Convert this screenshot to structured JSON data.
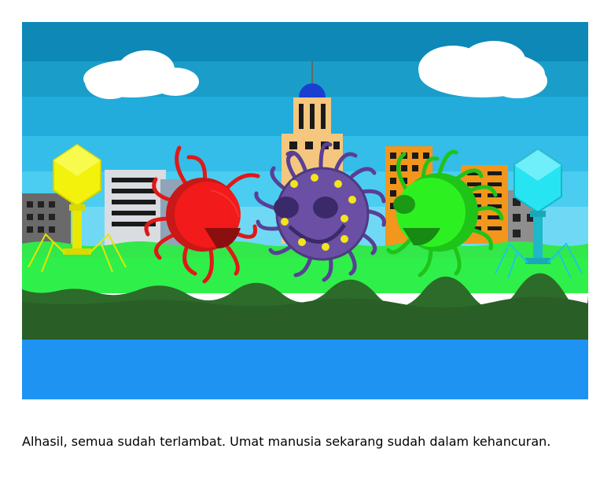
{
  "story": {
    "caption": "Alhasil, semua sudah terlambat. Umat manusia sekarang sudah dalam kehancuran."
  },
  "illustration": {
    "characters": [
      "yellow-bacteriophage",
      "red-virus",
      "purple-virus",
      "green-virus",
      "cyan-bacteriophage"
    ],
    "colors": {
      "sky_stripes": [
        "#0d88b7",
        "#1a9ec9",
        "#22acdc",
        "#33bde8",
        "#4acdf0",
        "#6fd9f5"
      ],
      "cloud": "#ffffff",
      "grass": "#2ff04a",
      "soil": "#2d6b2a",
      "water": "#1f93f2",
      "red_virus": "#e01818",
      "purple_virus": "#6b4fa5",
      "green_virus": "#22d619",
      "yellow_phage": "#f2f20c",
      "cyan_phage": "#27e4f2",
      "building_orange": "#f2961c",
      "building_tan": "#f5c77e"
    }
  }
}
